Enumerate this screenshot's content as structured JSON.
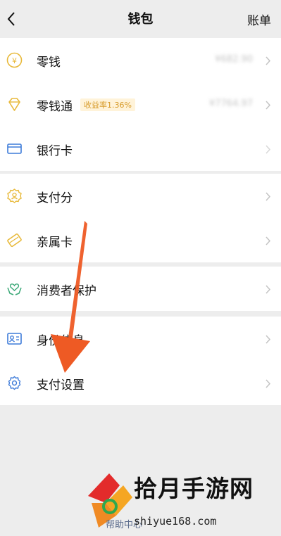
{
  "header": {
    "title": "钱包",
    "bill_label": "账单"
  },
  "groups": [
    {
      "items": [
        {
          "label": "零钱",
          "value": "¥682.90"
        },
        {
          "label": "零钱通",
          "badge": "收益率1.36%",
          "value": "¥7764.97"
        },
        {
          "label": "银行卡",
          "value": ""
        }
      ]
    },
    {
      "items": [
        {
          "label": "支付分"
        },
        {
          "label": "亲属卡"
        }
      ]
    },
    {
      "items": [
        {
          "label": "消费者保护"
        }
      ]
    },
    {
      "items": [
        {
          "label": "身份信息"
        },
        {
          "label": "支付设置"
        }
      ]
    }
  ],
  "footer": {
    "help_label": "帮助中心"
  },
  "watermark": {
    "brand": "拾月手游网",
    "url": "shiyue168.com"
  },
  "colors": {
    "background": "#ededed",
    "card": "#ffffff",
    "accent_gold": "#e8b93a",
    "accent_blue": "#3d7bd9",
    "accent_green": "#3aa877",
    "arrow": "#ee5a24"
  }
}
